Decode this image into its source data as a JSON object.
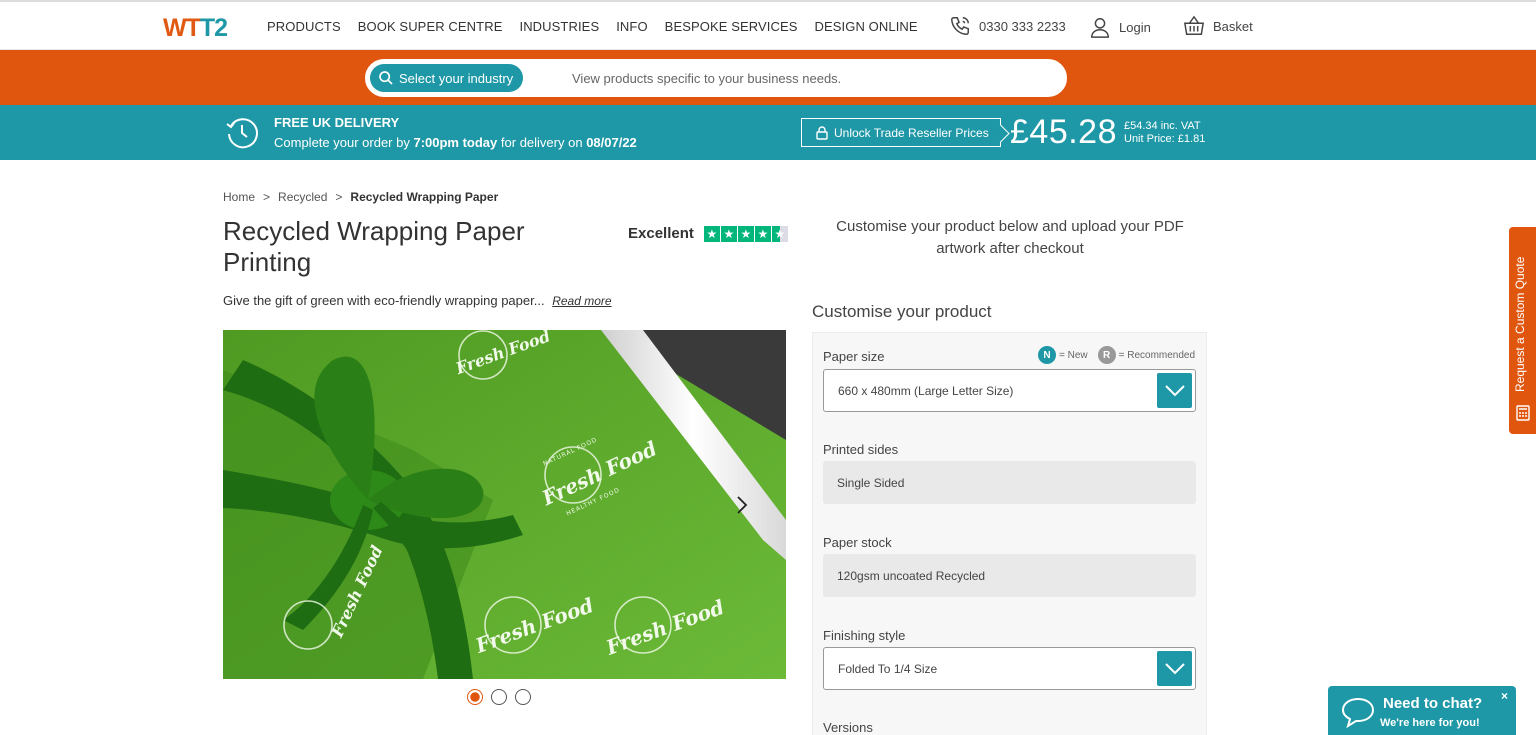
{
  "header": {
    "logo": {
      "part1": "WT",
      "part2": "T2"
    },
    "nav": [
      "PRODUCTS",
      "BOOK SUPER CENTRE",
      "INDUSTRIES",
      "INFO",
      "BESPOKE SERVICES",
      "DESIGN ONLINE"
    ],
    "phone": "0330 333 2233",
    "login": "Login",
    "basket": "Basket"
  },
  "industry_bar": {
    "button_label": "Select your industry",
    "placeholder": "View products specific to your business needs."
  },
  "delivery_bar": {
    "title": "FREE UK DELIVERY",
    "text_prefix": "Complete your order by",
    "time": "7:00pm today",
    "text_mid": "for delivery on",
    "date": "08/07/22",
    "unlock_label": "Unlock Trade Reseller Prices",
    "price": "£45.28",
    "price_inc_vat": "£54.34 inc. VAT",
    "unit_price": "Unit Price: £1.81"
  },
  "breadcrumb": [
    "Home",
    ">",
    "Recycled",
    ">",
    "Recycled Wrapping Paper"
  ],
  "product": {
    "title": "Recycled Wrapping Paper Printing",
    "rating_label": "Excellent",
    "rating_stars": 4.5,
    "description": "Give the gift of green with eco-friendly wrapping paper...",
    "read_more": "Read more",
    "image_brand": "Fresh Food",
    "image_small_top": "NATURAL FOOD",
    "image_small_bottom": "HEALTHY FOOD",
    "carousel_count": 3,
    "carousel_active": 1
  },
  "customise": {
    "intro": "Customise your product below and upload your PDF artwork after checkout",
    "title": "Customise your product",
    "legend_new_badge": "N",
    "legend_new": "= New",
    "legend_rec_badge": "R",
    "legend_rec": "= Recommended",
    "fields": {
      "paper_size": {
        "label": "Paper size",
        "value": "660 x 480mm (Large Letter Size)"
      },
      "printed_sides": {
        "label": "Printed sides",
        "value": "Single Sided"
      },
      "paper_stock": {
        "label": "Paper stock",
        "value": "120gsm uncoated Recycled"
      },
      "finishing": {
        "label": "Finishing style",
        "value": "Folded To 1/4 Size"
      },
      "versions": {
        "label": "Versions"
      }
    }
  },
  "side_tab": "Request a Custom Quote",
  "chat": {
    "title": "Need to chat?",
    "subtitle": "We're here for you!",
    "close": "×"
  }
}
